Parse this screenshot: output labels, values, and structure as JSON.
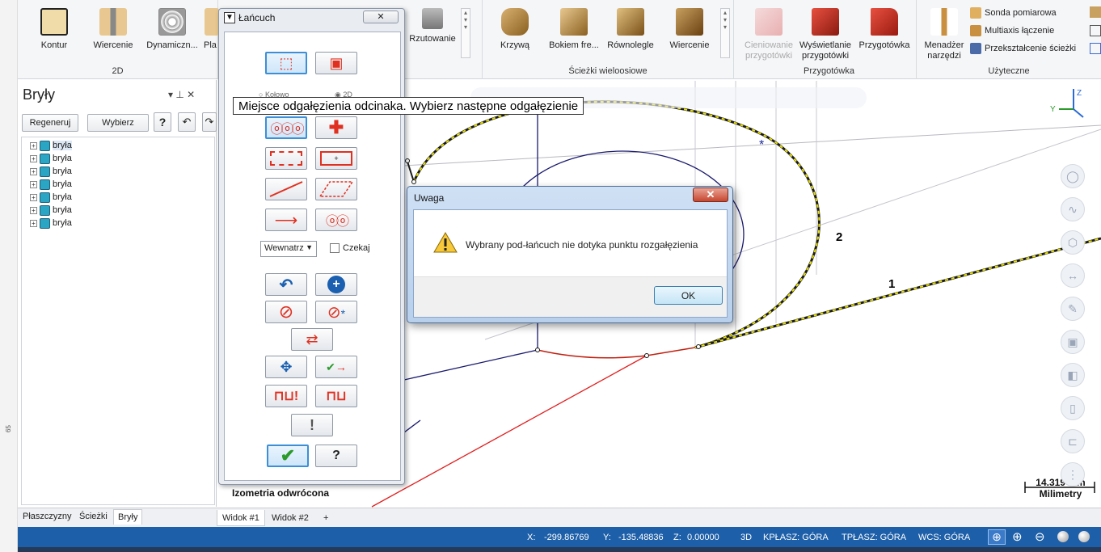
{
  "ribbon": {
    "groups": {
      "g2d": "2D",
      "multiaxis": "Ścieżki wieloosiowe",
      "stock": "Przygotówka",
      "utility": "Użyteczne"
    },
    "buttons": {
      "contour": "Kontur",
      "drill": "Wiercenie",
      "dynamic": "Dynamiczn...",
      "pla": "Pla",
      "projection": "Rzutowanie",
      "curve": "Krzywą",
      "swarf": "Bokiem fre...",
      "parallel": "Równolegle",
      "multi_drill": "Wiercenie",
      "stock_shade_1": "Cieniowanie",
      "stock_shade_2": "przygotówki",
      "stock_display_1": "Wyświetlanie",
      "stock_display_2": "przygotówki",
      "stock": "Przygotówka",
      "tool_mgr_1": "Menadżer",
      "tool_mgr_2": "narzędzi",
      "probe": "Sonda pomiarowa",
      "multiaxis_link": "Multiaxis łączenie",
      "transform": "Przekształcenie ścieżki"
    }
  },
  "panel": {
    "title": "Bryły",
    "pin": "▾ ⊥ ✕",
    "regen": "Regeneruj",
    "select": "Wybierz",
    "help": "?",
    "tree": [
      {
        "label": "bryła"
      },
      {
        "label": "bryła"
      },
      {
        "label": "bryła"
      },
      {
        "label": "bryła"
      },
      {
        "label": "bryła"
      },
      {
        "label": "bryła"
      },
      {
        "label": "bryła"
      }
    ],
    "tabs": {
      "planes": "Płaszczyzny",
      "paths": "Ścieżki",
      "solids": "Bryły"
    },
    "ruler": {
      "a": "65"
    }
  },
  "chain": {
    "title": "Łańcuch",
    "close": "✕",
    "radio_partial": "Kołowo",
    "radio_2d": "2D",
    "mode_select": "Wewnatrz",
    "wait_label": "Czekaj",
    "help": "?"
  },
  "tooltip": "Miejsce odgałęzienia odcinaka. Wybierz następne odgałęzienie",
  "alert": {
    "title": "Uwaga",
    "close": "✕",
    "message": "Wybrany pod-łańcuch nie dotyka punktu rozgałęzienia",
    "ok": "OK"
  },
  "viewport": {
    "view_name": "Izometria odwrócona",
    "label_1": "1",
    "label_2": "2",
    "scale_value": "14.319 mm",
    "scale_unit": "Milimetry",
    "tabs": {
      "v1": "Widok #1",
      "v2": "Widok #2",
      "add": "+"
    }
  },
  "status": {
    "x_label": "X:",
    "x_value": "-299.86769",
    "y_label": "Y:",
    "y_value": "-135.48836",
    "z_label": "Z:",
    "z_value": "0.00000",
    "mode": "3D",
    "cplane": "KPŁASZ: GÓRA",
    "tplane": "TPŁASZ: GÓRA",
    "wcs": "WCS: GÓRA"
  },
  "colors": {
    "accent": "#1d5fa8",
    "curve": "#1a1a6e",
    "chain_highlight": "#e8e000",
    "red_line": "#e02020"
  }
}
